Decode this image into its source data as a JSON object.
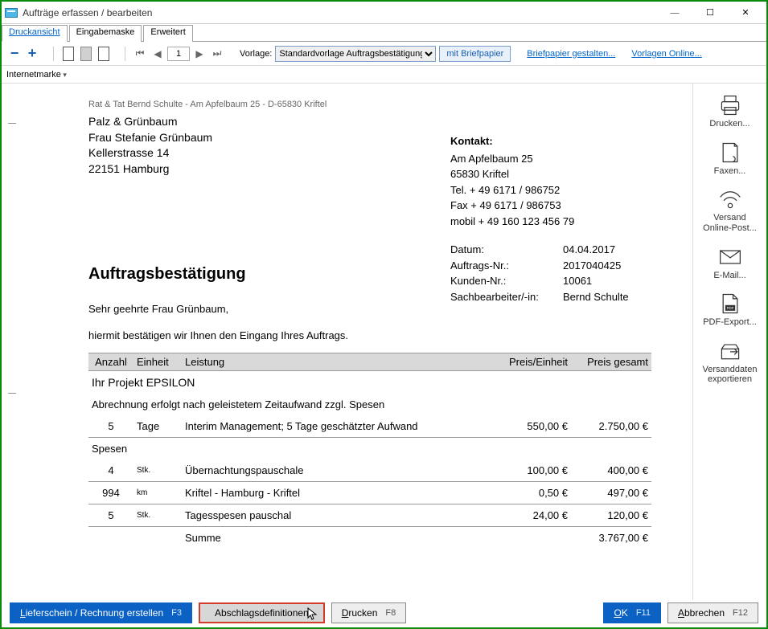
{
  "window": {
    "title": "Aufträge erfassen / bearbeiten"
  },
  "tabs": {
    "t1": "Druckansicht",
    "t2": "Eingabemaske",
    "t3": "Erweitert"
  },
  "toolbar": {
    "page_value": "1",
    "vorlage_label": "Vorlage:",
    "vorlage_selected": "Standardvorlage Auftragsbestätigung",
    "briefpapier_btn": "mit Briefpapier",
    "link_gestalten": "Briefpapier gestalten...",
    "link_online": "Vorlagen Online...",
    "internetmarke": "Internetmarke"
  },
  "document": {
    "sender_line": "Rat & Tat Bernd Schulte - Am Apfelbaum 25 - D-65830 Kriftel",
    "recipient": {
      "l1": "Palz & Grünbaum",
      "l2": "Frau Stefanie Grünbaum",
      "l3": "Kellerstrasse 14",
      "l4": "22151 Hamburg"
    },
    "contact": {
      "heading": "Kontakt:",
      "l1": "Am Apfelbaum 25",
      "l2": "65830 Kriftel",
      "l3": "Tel. + 49 6171 / 986752",
      "l4": "Fax + 49 6171 / 986753",
      "l5": "mobil + 49 160 123 456 79"
    },
    "meta": {
      "date_k": "Datum:",
      "date_v": "04.04.2017",
      "order_k": "Auftrags-Nr.:",
      "order_v": "2017040425",
      "cust_k": "Kunden-Nr.:",
      "cust_v": "10061",
      "clerk_k": "Sachbearbeiter/-in:",
      "clerk_v": "Bernd Schulte"
    },
    "title": "Auftragsbestätigung",
    "salutation": "Sehr geehrte Frau Grünbaum,",
    "intro": "hiermit bestätigen wir Ihnen den Eingang Ihres Auftrags.",
    "columns": {
      "qty": "Anzahl",
      "unit": "Einheit",
      "desc": "Leistung",
      "price": "Preis/Einheit",
      "total": "Preis gesamt"
    },
    "project": "Ihr Projekt EPSILON",
    "note": "Abrechnung erfolgt nach geleistetem Zeitaufwand zzgl. Spesen",
    "rows": [
      {
        "qty": "5",
        "unit": "Tage",
        "desc": "Interim Management; 5 Tage geschätzter Aufwand",
        "price": "550,00 €",
        "total": "2.750,00 €"
      }
    ],
    "spesen_label": "Spesen",
    "spesen_rows": [
      {
        "qty": "4",
        "unit": "Stk.",
        "desc": "Übernachtungspauschale",
        "price": "100,00 €",
        "total": "400,00 €"
      },
      {
        "qty": "994",
        "unit": "km",
        "desc": "Kriftel - Hamburg - Kriftel",
        "price": "0,50 €",
        "total": "497,00 €"
      },
      {
        "qty": "5",
        "unit": "Stk.",
        "desc": "Tagesspesen pauschal",
        "price": "24,00 €",
        "total": "120,00 €"
      }
    ],
    "sum_label": "Summe",
    "sum_total": "3.767,00 €"
  },
  "side": {
    "print": "Drucken...",
    "fax": "Faxen...",
    "send1": "Versand",
    "send2": "Online-Post...",
    "email": "E-Mail...",
    "pdf": "PDF-Export...",
    "ship1": "Versanddaten",
    "ship2": "exportieren"
  },
  "footer": {
    "lieferschein": "Lieferschein / Rechnung erstellen",
    "lieferschein_key": "F3",
    "abschlag": "Abschlagsdefinitionen",
    "drucken": "Drucken",
    "drucken_key": "F8",
    "ok": "OK",
    "ok_key": "F11",
    "abbrechen": "Abbrechen",
    "abbrechen_key": "F12"
  }
}
